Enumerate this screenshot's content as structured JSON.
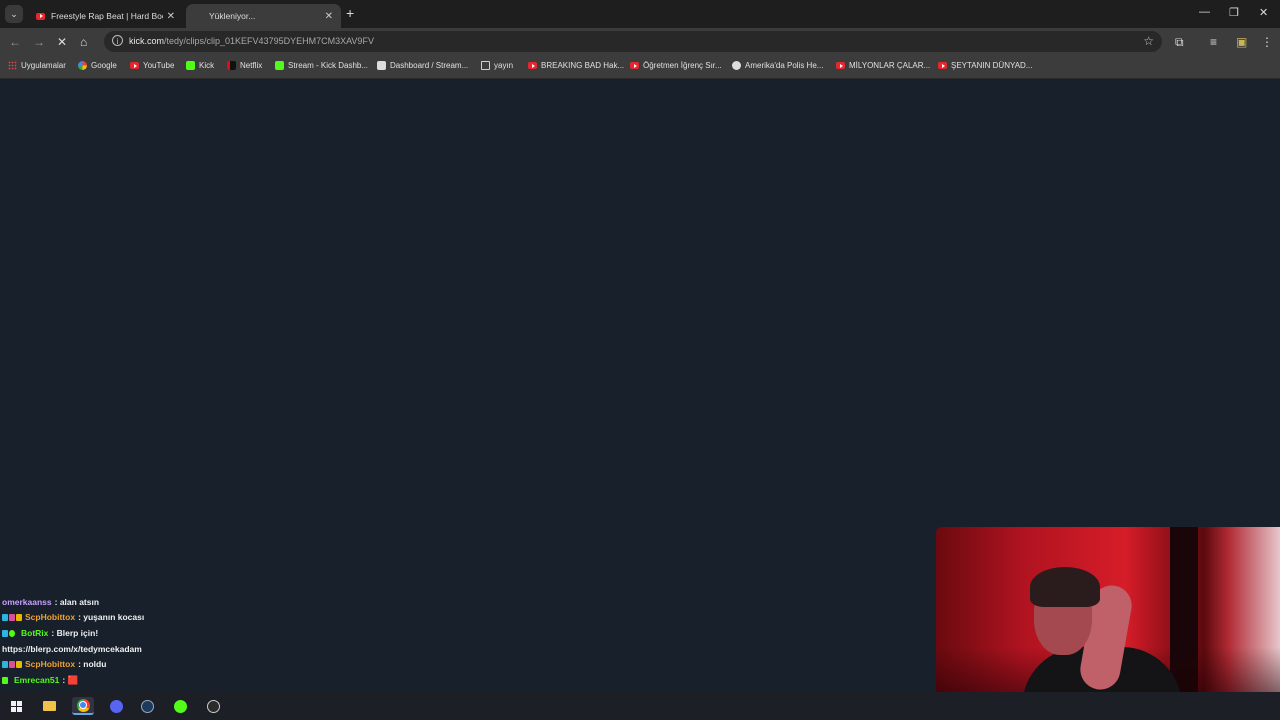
{
  "browser": {
    "tabs": [
      {
        "title": "Freestyle Rap Beat | Hard Boom",
        "active": false,
        "favicon": "youtube-icon"
      },
      {
        "title": "Yükleniyor...",
        "active": true,
        "favicon": "loading-icon"
      }
    ],
    "url": {
      "domain": "kick.com",
      "path": "/tedy/clips/clip_01KEFV43795DYEHM7CM3XAV9FV"
    },
    "bookmarks": [
      {
        "label": "Uygulamalar",
        "icon": "apps-grid-icon"
      },
      {
        "label": "Google",
        "icon": "google-icon"
      },
      {
        "label": "YouTube",
        "icon": "youtube-icon"
      },
      {
        "label": "Kick",
        "icon": "kick-icon"
      },
      {
        "label": "Netflix",
        "icon": "netflix-icon"
      },
      {
        "label": "Stream - Kick Dashb...",
        "icon": "kick-icon"
      },
      {
        "label": "Dashboard / Stream...",
        "icon": "dashboard-icon"
      },
      {
        "label": "yayın",
        "icon": "folder-icon"
      },
      {
        "label": "BREAKING BAD Hak...",
        "icon": "youtube-icon"
      },
      {
        "label": "Öğretmen İğrenç Sır...",
        "icon": "youtube-icon"
      },
      {
        "label": "Amerika'da Polis He...",
        "icon": "globe-icon"
      },
      {
        "label": "MİLYONLAR ÇALAR...",
        "icon": "youtube-icon"
      },
      {
        "label": "ŞEYTANIN DÜNYAD...",
        "icon": "youtube-icon"
      }
    ]
  },
  "chat": [
    {
      "user": "omerkaanss",
      "user_color": "#c9a0ff",
      "message": "alan atsın",
      "badges": []
    },
    {
      "user": "ScpHobittox",
      "user_color": "#f0a030",
      "message": "yuşanın kocası",
      "badges": [
        "#2fb3e0",
        "#d94fa0",
        "#e6b800"
      ]
    },
    {
      "user": "BotRix",
      "user_color": "#53fc18",
      "message": "Blerp için!",
      "badges": [
        "#2fb3e0",
        "#53fc18"
      ]
    },
    {
      "user": "",
      "user_color": "#ffffff",
      "message": "https://blerp.com/x/tedymcekadam",
      "badges": []
    },
    {
      "user": "ScpHobittox",
      "user_color": "#f0a030",
      "message": "noldu",
      "badges": [
        "#2fb3e0",
        "#d94fa0",
        "#e6b800"
      ]
    },
    {
      "user": "Emrecan51",
      "user_color": "#53fc18",
      "message": "🟥",
      "badges": [
        "#53fc18"
      ]
    }
  ],
  "colors": {
    "page_bg": "#17202b",
    "kick_green": "#53fc18",
    "youtube_red": "#e8262b"
  }
}
